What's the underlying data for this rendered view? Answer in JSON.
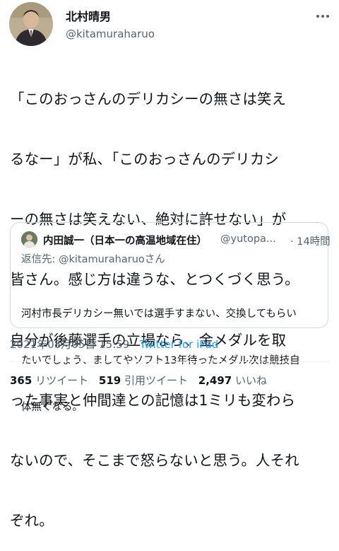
{
  "author": {
    "name": "北村晴男",
    "handle": "@kitamuraharuo"
  },
  "tweet": {
    "text_lines": [
      "「このおっさんのデリカシーの無さは笑え",
      "るなー」が私、「このおっさんのデリカシ",
      "ーの無さは笑えない、絶対に許せない」が",
      "皆さん。感じ方は違うな、とつくづく思う。",
      "自分が後藤選手の立場なら、金メダルを取",
      "った事実と仲間達との記憶は1ミリも変わら",
      "ないので、そこまで怒らないと思う。人それ",
      "ぞれ。"
    ]
  },
  "quote": {
    "name": "内田誠一（日本一の高温地域在住）",
    "handle": "@yutopa...",
    "time": "· 14時間",
    "reply_prefix": "返信先: ",
    "reply_mention": "@kitamuraharuo",
    "reply_suffix": "さん",
    "text_lines": [
      "河村市長デリカシー無いでは選手すまない、交換してもらい",
      "たいでしょう、ましてやソフト13年待ったメダル次は競技自",
      "体無くなる。"
    ]
  },
  "meta": {
    "datetime": "2021年08月05日 15:59",
    "separator": " · ",
    "source": "Twitter for iPad"
  },
  "stats": {
    "retweets_count": "365",
    "retweets_label": "リツイート",
    "quotes_count": "519",
    "quotes_label": "引用ツイート",
    "likes_count": "2,497",
    "likes_label": "いいね"
  }
}
